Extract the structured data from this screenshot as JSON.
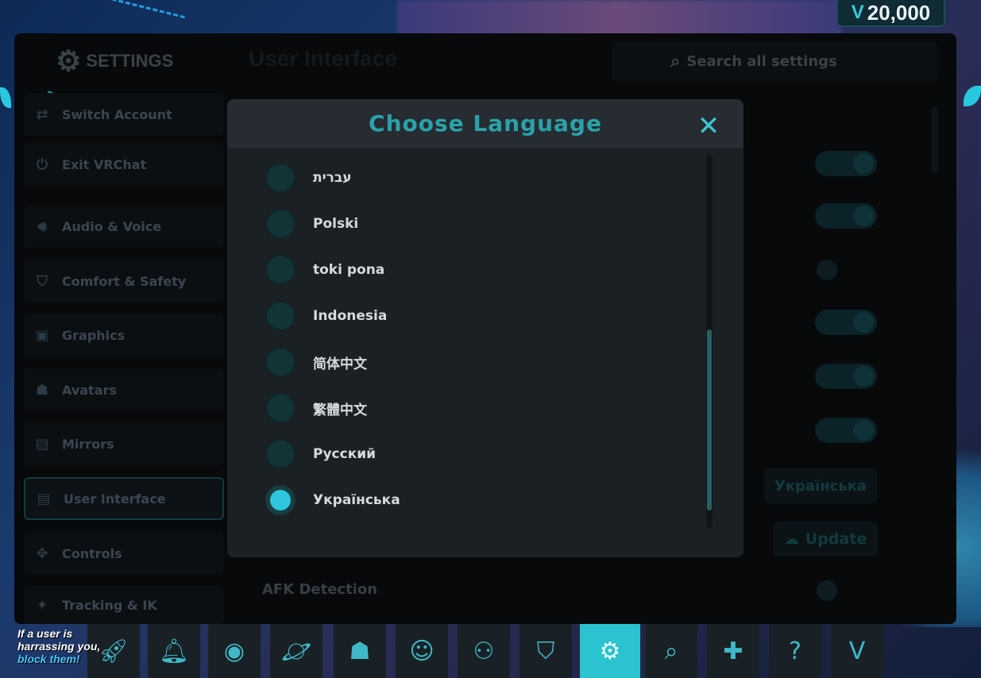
{
  "currency": {
    "amount": "20,000",
    "icon": "vrc-credits-icon"
  },
  "sidebar": {
    "title": "SETTINGS",
    "items": [
      {
        "label": "Switch Account",
        "icon": "switch-account-icon"
      },
      {
        "label": "Exit VRChat",
        "icon": "power-icon"
      },
      {
        "label": "Audio & Voice",
        "icon": "speaker-icon"
      },
      {
        "label": "Comfort & Safety",
        "icon": "shield-icon"
      },
      {
        "label": "Graphics",
        "icon": "image-icon"
      },
      {
        "label": "Avatars",
        "icon": "avatar-icon"
      },
      {
        "label": "Mirrors",
        "icon": "mirror-icon"
      },
      {
        "label": "User Interface",
        "icon": "monitor-icon",
        "active": true
      },
      {
        "label": "Controls",
        "icon": "gamepad-icon"
      },
      {
        "label": "Tracking & IK",
        "icon": "tracking-icon"
      }
    ]
  },
  "main": {
    "title": "User Interface",
    "search_placeholder": "Search all settings",
    "language_value": "Українська",
    "update_label": "Update",
    "afk_label": "AFK Detection"
  },
  "modal": {
    "title": "Choose Language",
    "languages": [
      {
        "label": "עברית",
        "selected": false
      },
      {
        "label": "Polski",
        "selected": false
      },
      {
        "label": "toki pona",
        "selected": false
      },
      {
        "label": "Indonesia",
        "selected": false
      },
      {
        "label": "简体中文",
        "selected": false
      },
      {
        "label": "繁體中文",
        "selected": false
      },
      {
        "label": "Русский",
        "selected": false
      },
      {
        "label": "Українська",
        "selected": true
      }
    ]
  },
  "dock": {
    "warning_line1": "If a user is",
    "warning_line2": "harrassing you,",
    "warning_line3": "block them!",
    "items": [
      "rocket-icon",
      "bell-icon",
      "profile-icon",
      "planet-icon",
      "avatars-icon",
      "people-icon",
      "network-icon",
      "shield-icon",
      "gear-icon",
      "search-icon",
      "chat-add-icon",
      "help-icon",
      "vrc-plus-icon"
    ]
  },
  "colors": {
    "accent": "#2ec6df",
    "modal_bg": "#1b2024",
    "title": "#2aa2a8"
  }
}
